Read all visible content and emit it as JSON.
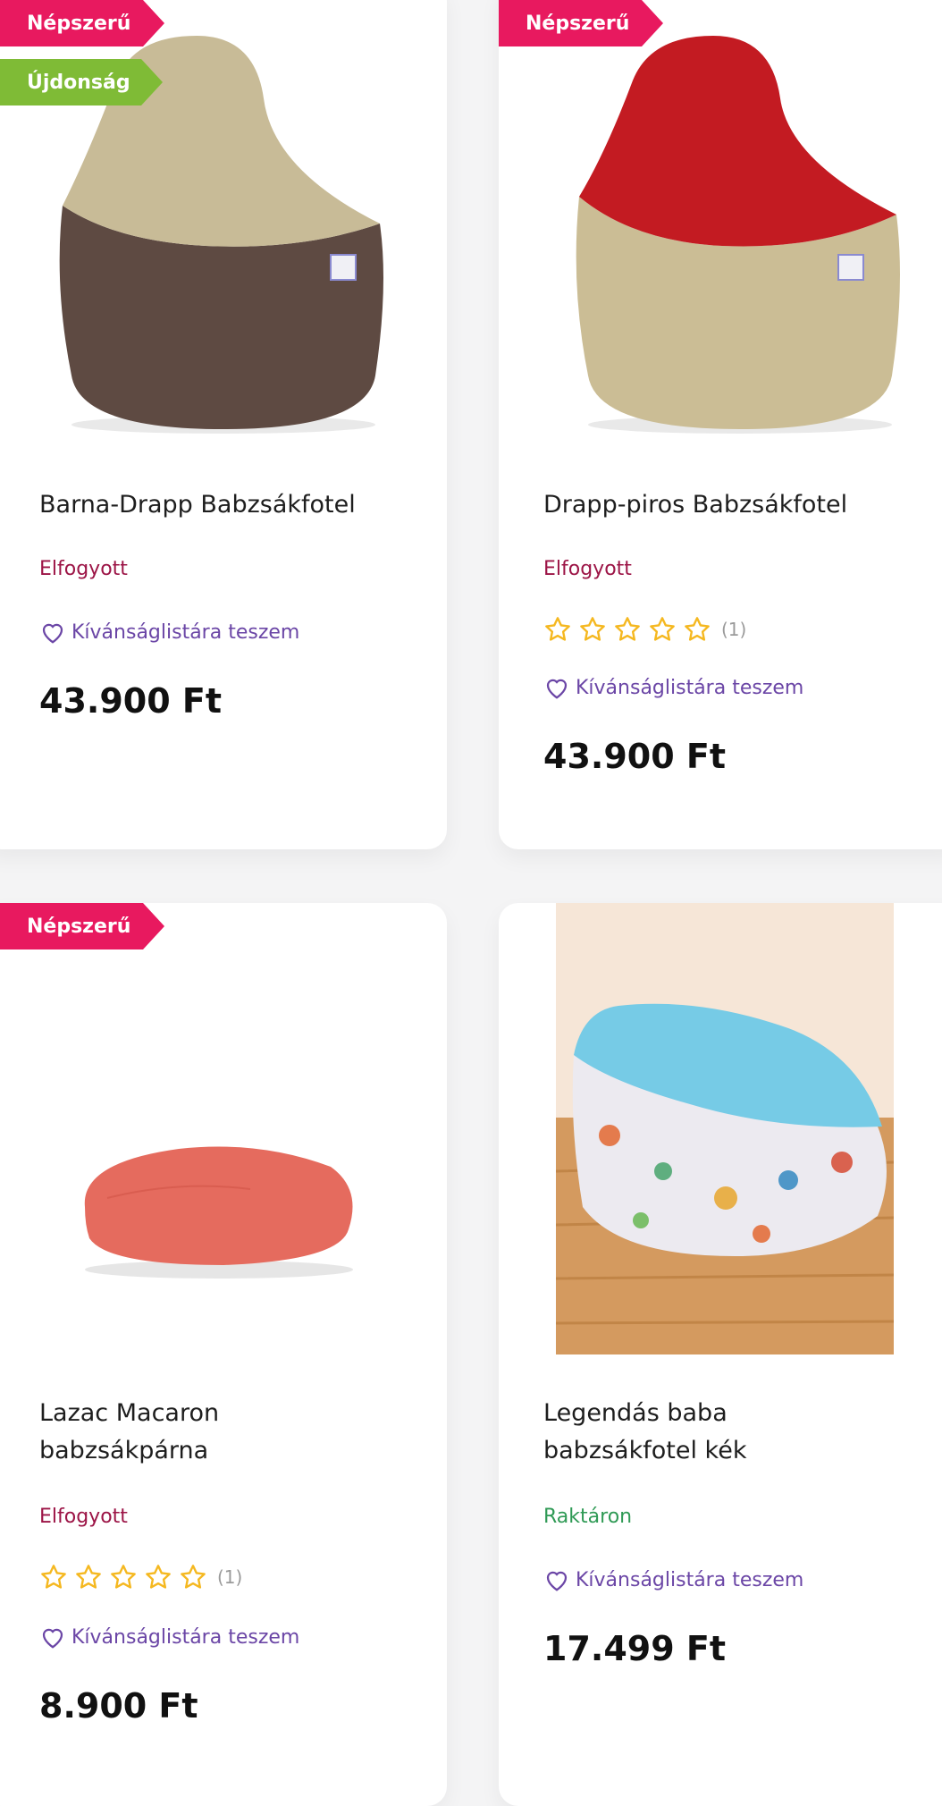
{
  "colors": {
    "badge_popular": "#e8195f",
    "badge_new": "#7fbb36",
    "out_of_stock": "#9c1446",
    "in_stock": "#2f9a55",
    "wishlist": "#6b46a6",
    "star": "#f5b820"
  },
  "products": [
    {
      "badges": [
        "Népszerű",
        "Újdonság"
      ],
      "title": "Barna-Drapp Babzsákfotel",
      "stock": "Elfogyott",
      "rating_count": "",
      "wishlist": "Kívánságlistára teszem",
      "price": "43.900 Ft"
    },
    {
      "badges": [
        "Népszerű"
      ],
      "title": "Drapp-piros Babzsákfotel",
      "stock": "Elfogyott",
      "rating_count": "(1)",
      "wishlist": "Kívánságlistára teszem",
      "price": "43.900 Ft"
    },
    {
      "badges": [
        "Népszerű"
      ],
      "title": "Lazac Macaron babzsákpárna",
      "stock": "Elfogyott",
      "rating_count": "(1)",
      "wishlist": "Kívánságlistára teszem",
      "price": "8.900 Ft"
    },
    {
      "badges": [],
      "title": "Legendás baba babzsákfotel kék",
      "stock": "Raktáron",
      "rating_count": "",
      "wishlist": "Kívánságlistára teszem",
      "price": "17.499 Ft"
    }
  ]
}
